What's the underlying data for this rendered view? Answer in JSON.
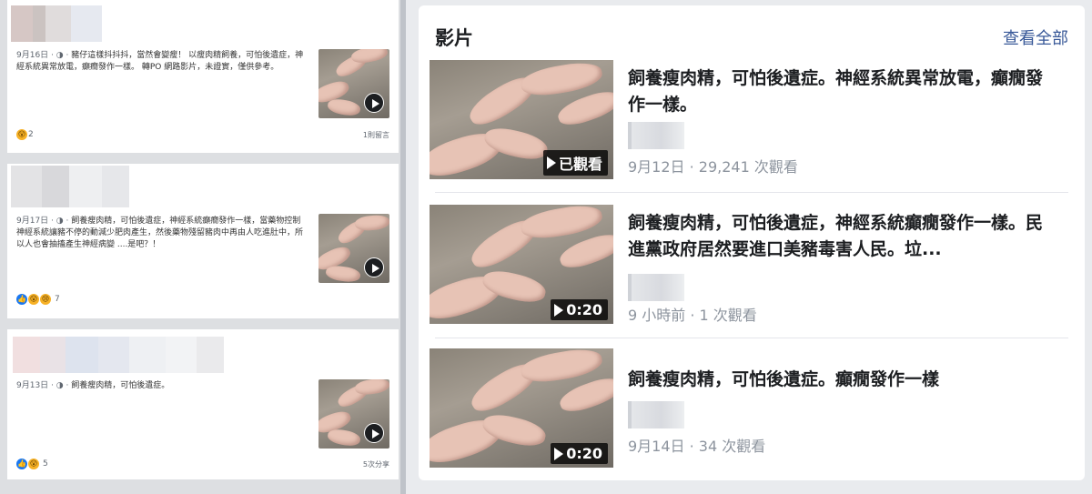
{
  "left_posts": [
    {
      "date": "9月16日",
      "text": "豬仔這樣抖抖抖，當然會變瘦！ 以瘦肉精飼養，可怕後遺症，神經系統異常放電，癲癇發作一樣。 轉PO 網路影片，未證實，僅供參考。",
      "reaction_count": "2",
      "footer": "1則留言"
    },
    {
      "date": "9月17日",
      "text": "飼養瘦肉精，可怕後遺症，神經系統癲癇發作一樣，當藥物控制神經系統讓豬不停的動減少肥肉產生，然後藥物殘留豬肉中再由人吃進肚中，所以人也會抽搐產生神經病變 ....是吧？！",
      "reaction_count": "7",
      "footer": ""
    },
    {
      "date": "9月13日",
      "text": "飼養瘦肉精，可怕後遺症。",
      "reaction_count": "5",
      "footer": "5次分享"
    }
  ],
  "panel": {
    "title": "影片",
    "see_all": "查看全部"
  },
  "videos": [
    {
      "title": "飼養瘦肉精，可怕後遺症。神經系統異常放電，癲癇發作一樣。",
      "badge": "已觀看",
      "meta": "9月12日 · 29,241 次觀看"
    },
    {
      "title": "飼養瘦肉精，可怕後遺症，神經系統癲癇發作一樣。民進黨政府居然要進口美豬毒害人民。垃...",
      "badge": "0:20",
      "meta": "9 小時前 · 1 次觀看"
    },
    {
      "title": "飼養瘦肉精，可怕後遺症。癲癇發作一樣",
      "badge": "0:20",
      "meta": "9月14日 · 34 次觀看"
    }
  ],
  "icons": {
    "play": "play-icon",
    "wow": "wow-reaction-icon",
    "like": "like-reaction-icon",
    "sad": "sad-reaction-icon",
    "globe": "globe-icon"
  },
  "colors": {
    "link": "#385898",
    "page_bg": "#e9ebee",
    "meta_gray": "#8d949e"
  }
}
